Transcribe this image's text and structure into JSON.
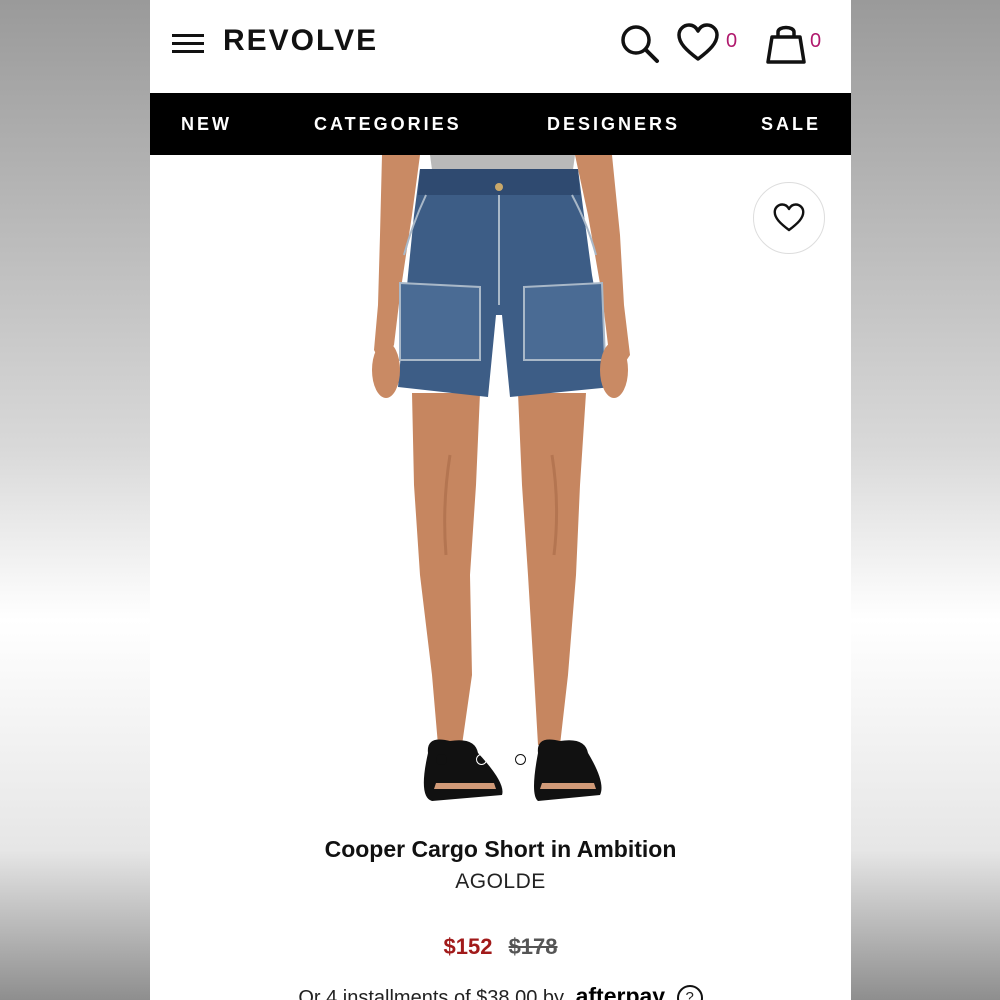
{
  "header": {
    "logo": "REVOLVE",
    "wishlist_count": "0",
    "bag_count": "0",
    "icons": [
      "menu-icon",
      "search-icon",
      "heart-icon",
      "bag-icon"
    ]
  },
  "nav": {
    "items": [
      {
        "label": "NEW"
      },
      {
        "label": "CATEGORIES"
      },
      {
        "label": "DESIGNERS"
      },
      {
        "label": "SALE"
      }
    ]
  },
  "product": {
    "title": "Cooper Cargo Short in Ambition",
    "brand": "AGOLDE",
    "sale_price": "$152",
    "original_price": "$178",
    "installments_text": "Or 4 installments of $38.00 by",
    "installments_provider": "afterpay",
    "info_symbol": "?",
    "image_count": 3,
    "active_image": 1
  },
  "colors": {
    "nav_background": "#000000",
    "badge_accent": "#b0196d",
    "sale_price": "#a11a1a"
  }
}
